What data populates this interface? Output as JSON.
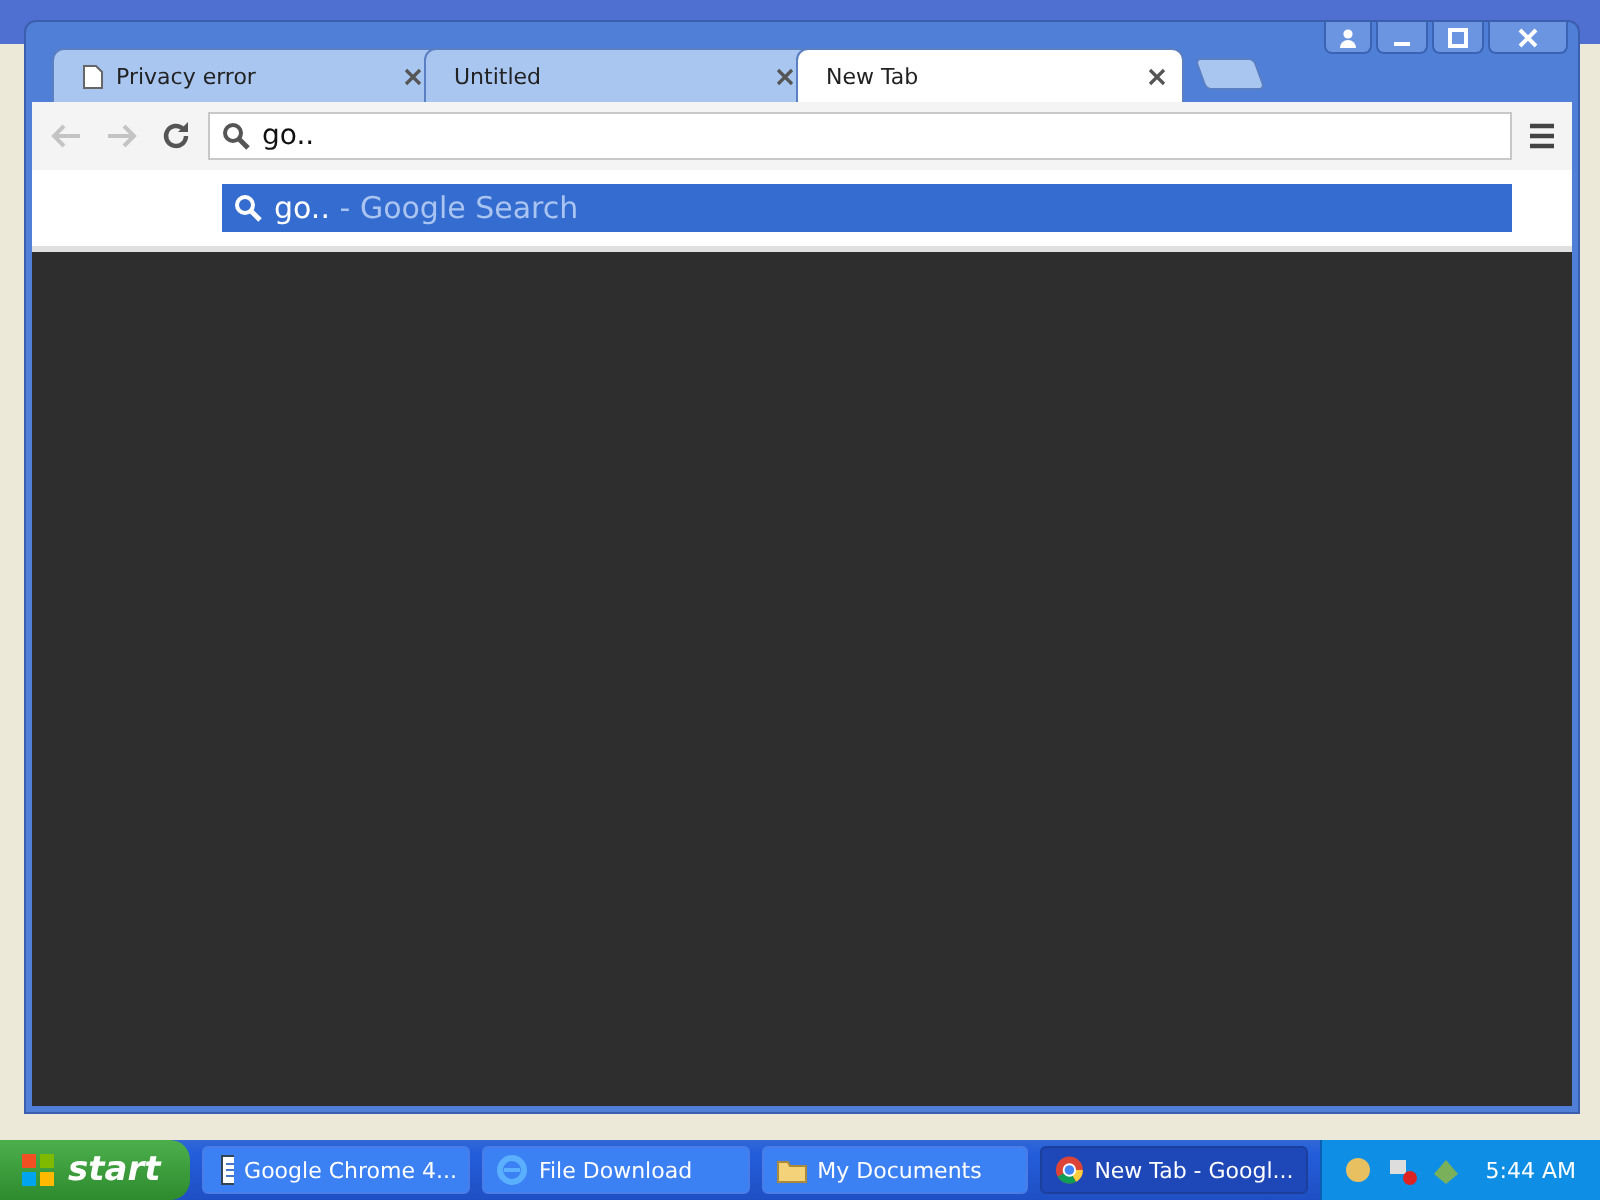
{
  "browser": {
    "tabs": [
      {
        "title": "Privacy error",
        "page_icon": true,
        "selected": false
      },
      {
        "title": "Untitled",
        "page_icon": false,
        "selected": false
      },
      {
        "title": "New Tab",
        "page_icon": false,
        "selected": true
      }
    ],
    "nav": {
      "back_disabled": true,
      "forward_disabled": true
    },
    "omnibox": {
      "value": "go.."
    },
    "suggestions": [
      {
        "query": "go..",
        "detail": "- Google Search",
        "selected": true
      }
    ]
  },
  "taskbar": {
    "start": "start",
    "items": [
      {
        "label": "Google Chrome 4...",
        "kind": "document",
        "selected": false
      },
      {
        "label": "File Download",
        "kind": "ie",
        "selected": false
      },
      {
        "label": "My Documents",
        "kind": "folder",
        "selected": false
      },
      {
        "label": "New Tab - Googl...",
        "kind": "chrome",
        "selected": true
      }
    ],
    "clock": "5:44 AM"
  }
}
